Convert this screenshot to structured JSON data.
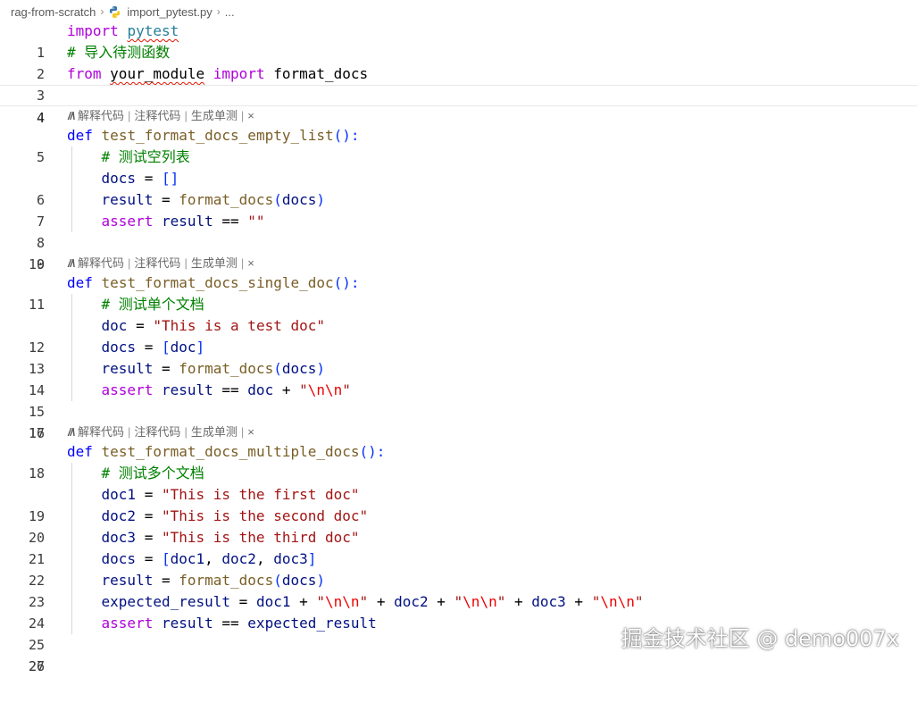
{
  "breadcrumb": {
    "folder": "rag-from-scratch",
    "file": "import_pytest.py",
    "more": "..."
  },
  "codelens": {
    "explain": "解释代码",
    "comment": "注释代码",
    "unittest": "生成单测",
    "close": "×",
    "sep": "|"
  },
  "lines": {
    "l1": {
      "num": "1",
      "t1": "import",
      "t2": "pytest"
    },
    "l2": {
      "num": "2",
      "t1": "# 导入待测函数"
    },
    "l3": {
      "num": "3",
      "t1": "from",
      "t2": "your_module",
      "t3": "import",
      "t4": "format_docs"
    },
    "l4": {
      "num": "4"
    },
    "l5": {
      "num": "5",
      "t1": "def",
      "t2": "test_format_docs_empty_list",
      "t3": "():"
    },
    "l6": {
      "num": "6",
      "t1": "# 测试空列表"
    },
    "l7": {
      "num": "7",
      "t1": "docs",
      "t2": " = ",
      "t3": "[]"
    },
    "l8": {
      "num": "8",
      "t1": "result",
      "t2": " = ",
      "t3": "format_docs",
      "t4": "(",
      "t5": "docs",
      "t6": ")"
    },
    "l9": {
      "num": "9",
      "t1": "assert",
      "t2": "result",
      "t3": " == ",
      "t4": "\"\""
    },
    "l10": {
      "num": "10"
    },
    "l11": {
      "num": "11",
      "t1": "def",
      "t2": "test_format_docs_single_doc",
      "t3": "():"
    },
    "l12": {
      "num": "12",
      "t1": "# 测试单个文档"
    },
    "l13": {
      "num": "13",
      "t1": "doc",
      "t2": " = ",
      "t3": "\"This is a test doc\""
    },
    "l14": {
      "num": "14",
      "t1": "docs",
      "t2": " = ",
      "t3": "[",
      "t4": "doc",
      "t5": "]"
    },
    "l15": {
      "num": "15",
      "t1": "result",
      "t2": " = ",
      "t3": "format_docs",
      "t4": "(",
      "t5": "docs",
      "t6": ")"
    },
    "l16": {
      "num": "16",
      "t1": "assert",
      "t2": "result",
      "t3": " == ",
      "t4": "doc",
      "t5": " + ",
      "t6": "\"",
      "t7": "\\n\\n",
      "t8": "\""
    },
    "l17": {
      "num": "17"
    },
    "l18": {
      "num": "18",
      "t1": "def",
      "t2": "test_format_docs_multiple_docs",
      "t3": "():"
    },
    "l19": {
      "num": "19",
      "t1": "# 测试多个文档"
    },
    "l20": {
      "num": "20",
      "t1": "doc1",
      "t2": " = ",
      "t3": "\"This is the first doc\""
    },
    "l21": {
      "num": "21",
      "t1": "doc2",
      "t2": " = ",
      "t3": "\"This is the second doc\""
    },
    "l22": {
      "num": "22",
      "t1": "doc3",
      "t2": " = ",
      "t3": "\"This is the third doc\""
    },
    "l23": {
      "num": "23",
      "t1": "docs",
      "t2": " = ",
      "t3": "[",
      "t4": "doc1",
      "t5": ", ",
      "t6": "doc2",
      "t7": ", ",
      "t8": "doc3",
      "t9": "]"
    },
    "l24": {
      "num": "24",
      "t1": "result",
      "t2": " = ",
      "t3": "format_docs",
      "t4": "(",
      "t5": "docs",
      "t6": ")"
    },
    "l25": {
      "num": "25",
      "t1": "expected_result",
      "t2": " = ",
      "t3": "doc1",
      "t4": " + ",
      "t5": "\"",
      "t6": "\\n\\n",
      "t7": "\"",
      "t8": " + ",
      "t9": "doc2",
      "t10": " + ",
      "t11": "\"",
      "t12": "\\n\\n",
      "t13": "\"",
      "t14": " + ",
      "t15": "doc3",
      "t16": " + ",
      "t17": "\"",
      "t18": "\\n\\n",
      "t19": "\""
    },
    "l26": {
      "num": "26",
      "t1": "assert",
      "t2": "result",
      "t3": " == ",
      "t4": "expected_result"
    },
    "l27": {
      "num": "27"
    }
  },
  "watermark": "掘金技术社区 @ demo007x"
}
